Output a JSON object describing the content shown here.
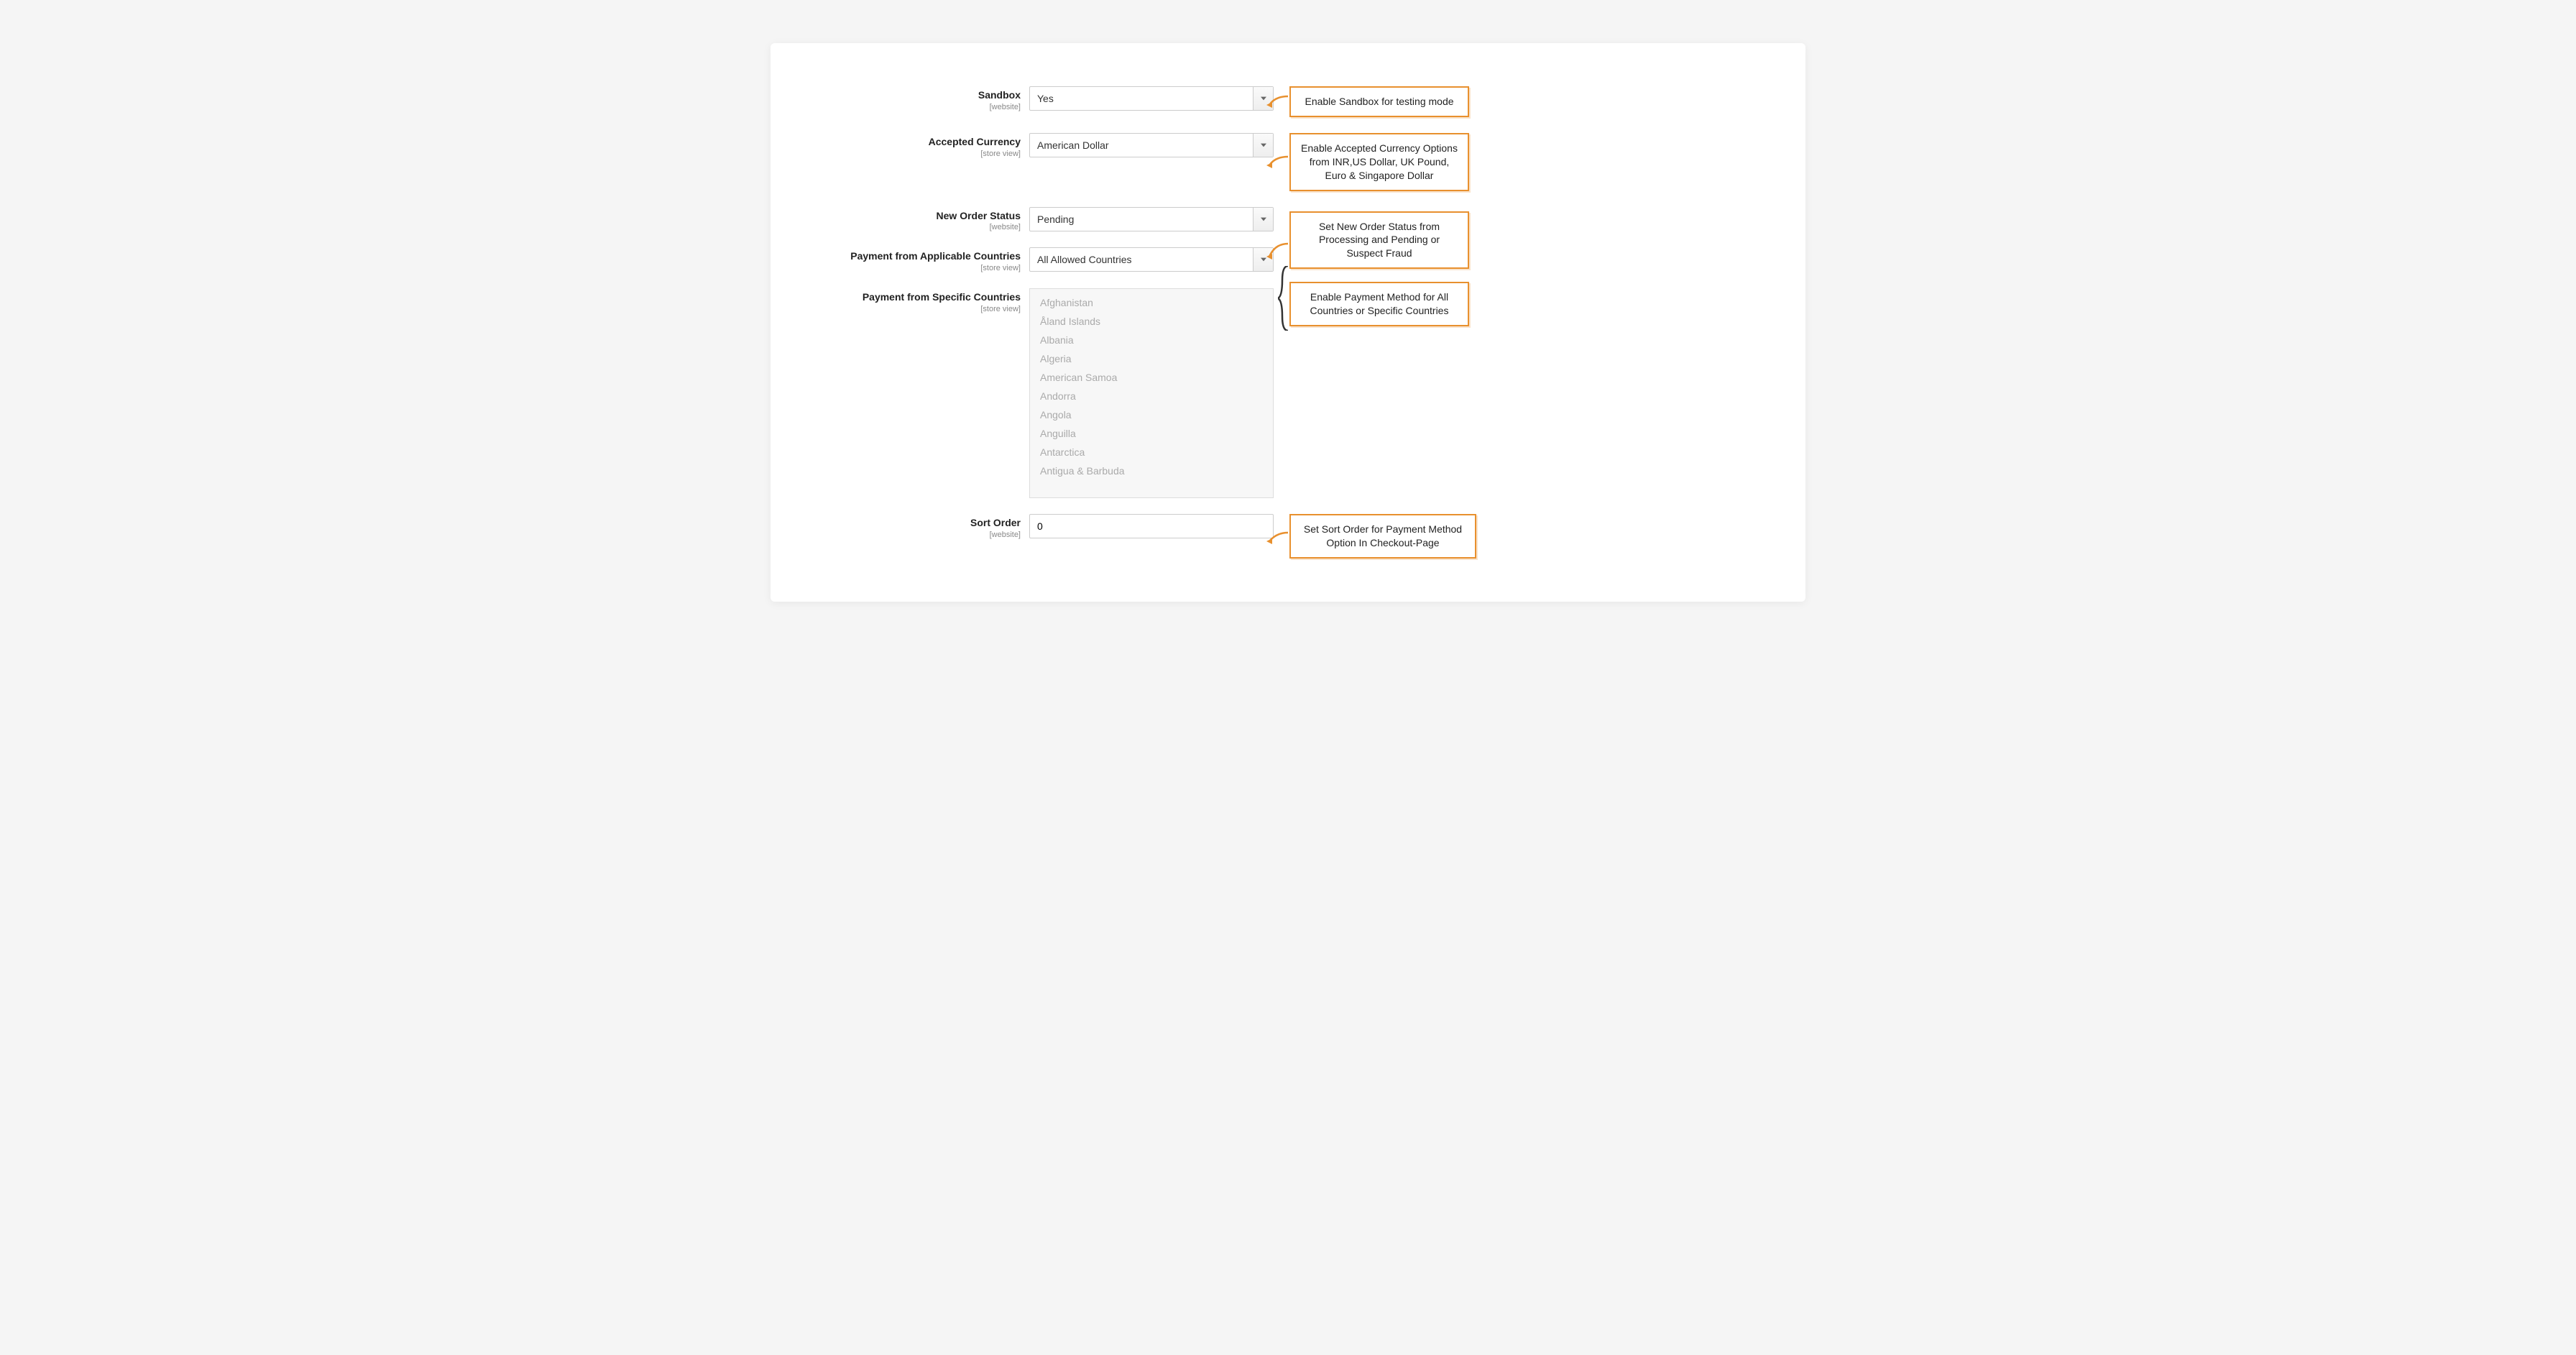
{
  "fields": {
    "sandbox": {
      "label": "Sandbox",
      "scope": "[website]",
      "value": "Yes"
    },
    "currency": {
      "label": "Accepted Currency",
      "scope": "[store view]",
      "value": "American Dollar"
    },
    "orderStatus": {
      "label": "New Order Status",
      "scope": "[website]",
      "value": "Pending"
    },
    "applicableCountries": {
      "label": "Payment from Applicable Countries",
      "scope": "[store view]",
      "value": "All Allowed Countries"
    },
    "specificCountries": {
      "label": "Payment from Specific Countries",
      "scope": "[store view]",
      "options": [
        "Afghanistan",
        "Åland Islands",
        "Albania",
        "Algeria",
        "American Samoa",
        "Andorra",
        "Angola",
        "Anguilla",
        "Antarctica",
        "Antigua & Barbuda"
      ]
    },
    "sortOrder": {
      "label": "Sort Order",
      "scope": "[website]",
      "value": "0"
    }
  },
  "callouts": {
    "sandbox": "Enable Sandbox for testing mode",
    "currency": "Enable Accepted Currency Options from INR,US Dollar, UK Pound, Euro & Singapore Dollar",
    "orderStatus": "Set New Order Status from Processing and Pending or Suspect Fraud",
    "countries": "Enable Payment Method for All Countries or Specific Countries",
    "sortOrder": "Set Sort Order for Payment Method Option In Checkout-Page"
  }
}
